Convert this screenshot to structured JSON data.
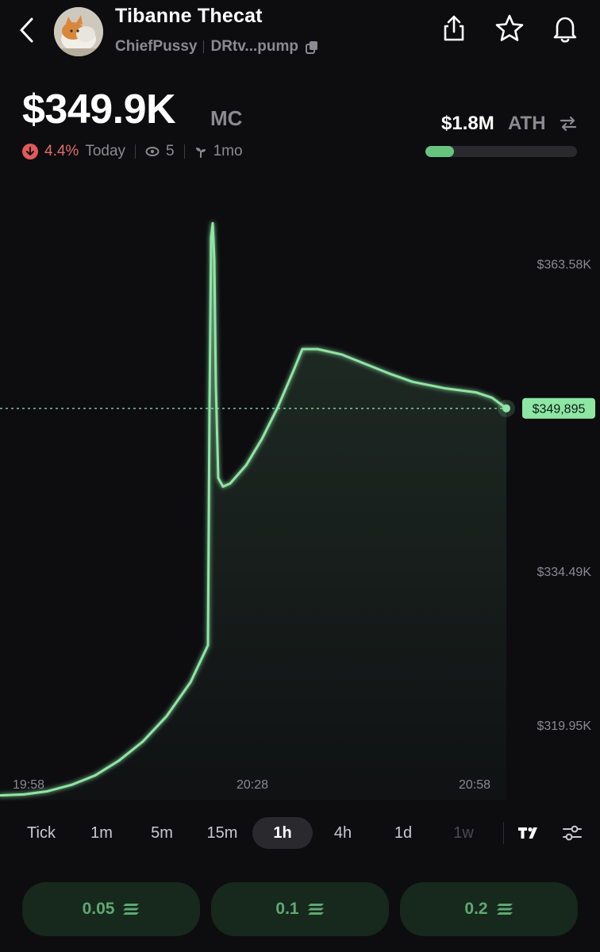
{
  "header": {
    "token_name": "Tibanne Thecat",
    "creator": "ChiefPussy",
    "address": "DRtv...pump",
    "icons": [
      "back-icon",
      "share-icon",
      "star-icon",
      "bell-icon",
      "copy-icon"
    ]
  },
  "market": {
    "mc_value": "$349.9K",
    "mc_label": "MC",
    "change_pct": "4.4%",
    "change_period": "Today",
    "change_direction": "down",
    "watchers": "5",
    "age": "1mo",
    "ath_value": "$1.8M",
    "ath_label": "ATH",
    "ath_progress": 0.19
  },
  "colors": {
    "accent": "#8ee6a4",
    "down": "#e05a5a",
    "background": "#0d0d10",
    "muted": "#8a8a90"
  },
  "chart_data": {
    "type": "area",
    "y_tick_labels": [
      "$363.58K",
      "$334.49K",
      "$319.95K"
    ],
    "y_ticks": [
      363580,
      334490,
      319950
    ],
    "x_tick_labels": [
      "19:58",
      "20:28",
      "20:58"
    ],
    "current_price_label": "$349,895",
    "current_value": 349895,
    "ylim": [
      312000,
      372000
    ],
    "points": [
      [
        0,
        313300
      ],
      [
        30,
        313400
      ],
      [
        60,
        313700
      ],
      [
        90,
        314300
      ],
      [
        120,
        315200
      ],
      [
        150,
        316600
      ],
      [
        180,
        318400
      ],
      [
        210,
        320800
      ],
      [
        240,
        324000
      ],
      [
        262,
        327500
      ],
      [
        264,
        350000
      ],
      [
        266,
        366000
      ],
      [
        268,
        367400
      ],
      [
        270,
        364000
      ],
      [
        272,
        352000
      ],
      [
        275,
        343300
      ],
      [
        281,
        342500
      ],
      [
        290,
        342800
      ],
      [
        310,
        344500
      ],
      [
        330,
        347000
      ],
      [
        350,
        350000
      ],
      [
        370,
        353500
      ],
      [
        381,
        355500
      ],
      [
        400,
        355500
      ],
      [
        430,
        355000
      ],
      [
        460,
        354100
      ],
      [
        490,
        353200
      ],
      [
        520,
        352400
      ],
      [
        560,
        351800
      ],
      [
        600,
        351400
      ],
      [
        620,
        350900
      ],
      [
        638,
        349895
      ]
    ],
    "grid": false,
    "legend": "none"
  },
  "timeframes": {
    "items": [
      "Tick",
      "1m",
      "5m",
      "15m",
      "1h",
      "4h",
      "1d",
      "1w"
    ],
    "active": "1h",
    "disabled": [
      "1w"
    ]
  },
  "buy_buttons": [
    "0.05",
    "0.1",
    "0.2"
  ]
}
